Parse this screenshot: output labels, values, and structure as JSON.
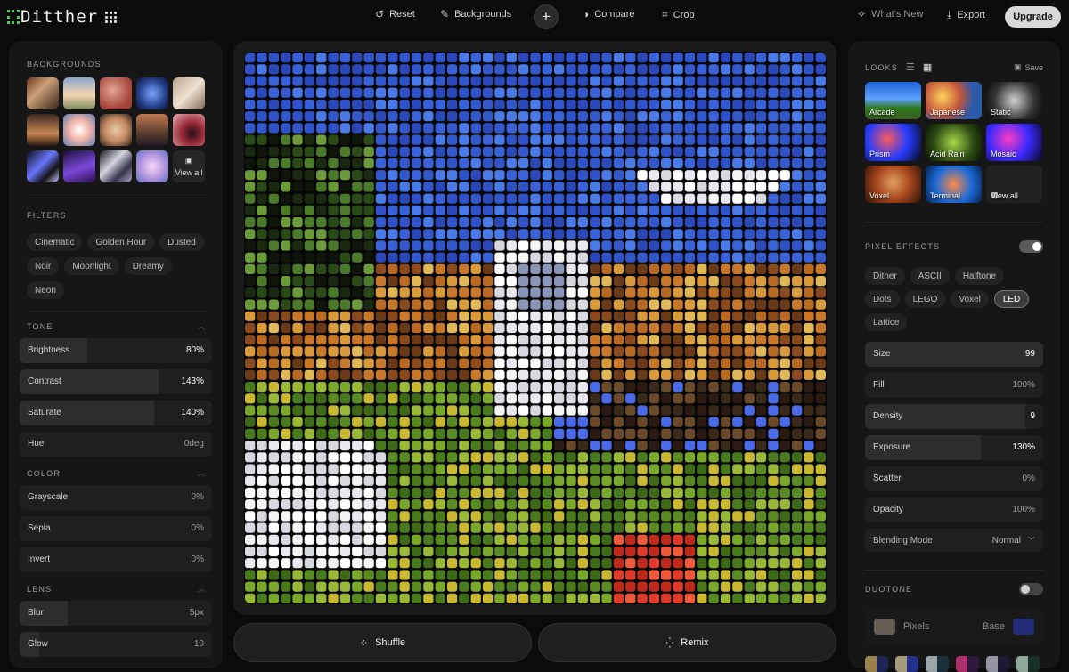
{
  "app": {
    "name": "Ditther"
  },
  "toolbar": {
    "reset": "Reset",
    "backgrounds": "Backgrounds",
    "compare": "Compare",
    "crop": "Crop",
    "whats_new": "What's New",
    "export": "Export",
    "upgrade": "Upgrade"
  },
  "left": {
    "backgrounds_title": "BACKGROUNDS",
    "view_all": "View all",
    "background_thumbs": [
      "archway-sunset",
      "cloudy-hills",
      "red-clouds",
      "blue-flower",
      "marble-arches",
      "stone-door",
      "pink-flower",
      "cream-flowers",
      "portrait",
      "purple-ring",
      "chrome-swirl",
      "purple-wave",
      "silk-ribbon",
      "lavender-flower"
    ],
    "filters_title": "FILTERS",
    "filters": [
      "Cinematic",
      "Golden Hour",
      "Dusted",
      "Noir",
      "Moonlight",
      "Dreamy",
      "Neon"
    ],
    "tone_title": "TONE",
    "tone": [
      {
        "label": "Brightness",
        "value": "80%",
        "level": 0.35
      },
      {
        "label": "Contrast",
        "value": "143%",
        "level": 0.72
      },
      {
        "label": "Saturate",
        "value": "140%",
        "level": 0.7
      },
      {
        "label": "Hue",
        "value": "0deg",
        "level": 0
      }
    ],
    "color_title": "COLOR",
    "color": [
      {
        "label": "Grayscale",
        "value": "0%",
        "level": 0
      },
      {
        "label": "Sepia",
        "value": "0%",
        "level": 0
      },
      {
        "label": "Invert",
        "value": "0%",
        "level": 0
      }
    ],
    "lens_title": "LENS",
    "lens": [
      {
        "label": "Blur",
        "value": "5px",
        "level": 0.25
      },
      {
        "label": "Glow",
        "value": "10",
        "level": 0.1
      }
    ]
  },
  "center": {
    "shuffle": "Shuffle",
    "remix": "Remix"
  },
  "right": {
    "looks_title": "LOOKS",
    "save": "Save",
    "view_all": "View all",
    "looks": [
      "Arcade",
      "Japanese",
      "Static",
      "Prism",
      "Acid Rain",
      "Mosaic",
      "Voxel",
      "Terminal"
    ],
    "pixel_effects_title": "PIXEL EFFECTS",
    "pixel_effects_on": true,
    "effects": [
      "Dither",
      "ASCII",
      "Halftone",
      "Dots",
      "LEGO",
      "Voxel",
      "LED",
      "Lattice"
    ],
    "active_effect": "LED",
    "params": [
      {
        "label": "Size",
        "value": "99",
        "level": 1.0
      },
      {
        "label": "Fill",
        "value": "100%",
        "level": 0
      },
      {
        "label": "Density",
        "value": "9",
        "level": 0.9
      },
      {
        "label": "Exposure",
        "value": "130%",
        "level": 0.65
      },
      {
        "label": "Scatter",
        "value": "0%",
        "level": 0
      },
      {
        "label": "Opacity",
        "value": "100%",
        "level": 0
      }
    ],
    "blending_label": "Blending Mode",
    "blending_value": "Normal",
    "duotone_title": "DUOTONE",
    "duotone_on": false,
    "pixels_label": "Pixels",
    "base_label": "Base",
    "pixels_color": "#a89c8a",
    "base_color": "#2a3ec2"
  },
  "colors": {
    "accent": "#3fd24a"
  }
}
